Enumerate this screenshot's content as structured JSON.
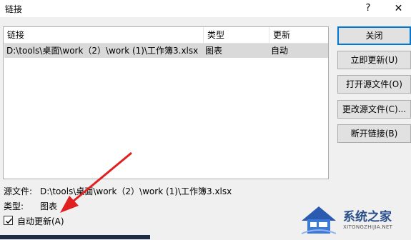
{
  "window": {
    "title": "链接",
    "help_glyph": "?",
    "close_glyph": "✕"
  },
  "list": {
    "columns": [
      "链接",
      "类型",
      "更新"
    ],
    "rows": [
      {
        "source": "D:\\tools\\桌面\\work（2）\\work (1)\\工作簿3.xlsx",
        "type": "图表",
        "update": "自动"
      }
    ]
  },
  "buttons": {
    "close": "关闭",
    "update_now": "立即更新(U)",
    "open_source": "打开源文件(O)",
    "change_source": "更改源文件(C)...",
    "break_link": "断开链接(B)"
  },
  "details": {
    "source_label": "源文件:",
    "source_value": "D:\\tools\\桌面\\work（2）\\work (1)\\工作簿3.xlsx",
    "type_label": "类型:",
    "type_value": "图表"
  },
  "auto_update": {
    "label": "自动更新(A)",
    "checked": true
  },
  "watermark": {
    "text": "系统之家",
    "sub": "XITONGZHIJIA.NET"
  },
  "colors": {
    "accent": "#0078d7",
    "arrow": "#e02020"
  }
}
